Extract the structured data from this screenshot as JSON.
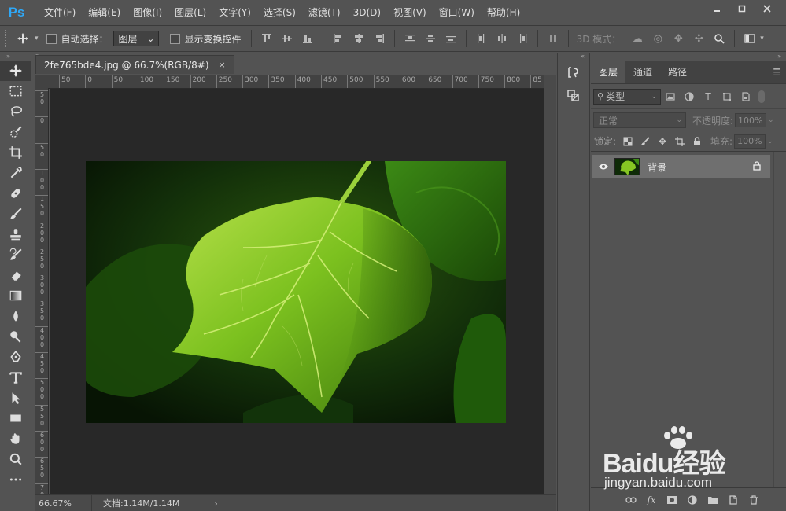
{
  "app": {
    "logo": "Ps",
    "menu": [
      "文件(F)",
      "编辑(E)",
      "图像(I)",
      "图层(L)",
      "文字(Y)",
      "选择(S)",
      "滤镜(T)",
      "3D(D)",
      "视图(V)",
      "窗口(W)",
      "帮助(H)"
    ],
    "window_buttons": [
      "minimize-icon",
      "restore-icon",
      "close-icon"
    ]
  },
  "options": {
    "auto_select_label": "自动选择：",
    "auto_select_target": "图层",
    "auto_select_checked": false,
    "show_transform_label": "显示变换控件",
    "show_transform_checked": false,
    "mode_3d_label": "3D 模式："
  },
  "document": {
    "tab_title": "2fe765bde4.jpg @ 66.7%(RGB/8#)",
    "close_glyph": "×",
    "ruler_h": [
      "50",
      "0",
      "50",
      "100",
      "150",
      "200",
      "250",
      "300",
      "350",
      "400",
      "450",
      "500",
      "550",
      "600",
      "650",
      "700",
      "750",
      "800",
      "85"
    ],
    "ruler_v": [
      "5\n0",
      "0",
      "5\n0",
      "1\n0\n0",
      "1\n5\n0",
      "2\n0\n0",
      "2\n5\n0",
      "3\n0\n0",
      "3\n5\n0",
      "4\n0\n0",
      "4\n5\n0",
      "5\n0\n0",
      "5\n5\n0",
      "6\n0\n0",
      "6\n5\n0",
      "7\n0\n0"
    ],
    "zoom": "66.67%",
    "doc_size": "文档:1.14M/1.14M",
    "status_arrow": "›"
  },
  "layers_panel": {
    "tabs": [
      "图层",
      "通道",
      "路径"
    ],
    "active_tab": 0,
    "filter_kind": "类型",
    "blend_mode": "正常",
    "opacity_label": "不透明度:",
    "opacity_value": "100%",
    "lock_label": "锁定:",
    "fill_label": "填充:",
    "fill_value": "100%",
    "layers": [
      {
        "name": "背景",
        "visible": true,
        "locked": true
      }
    ]
  },
  "watermark": {
    "brand": "Baidu经验",
    "url": "jingyan.baidu.com"
  },
  "colors": {
    "accent": "#2fa8f7",
    "bg": "#535353",
    "canvas": "#282828"
  }
}
